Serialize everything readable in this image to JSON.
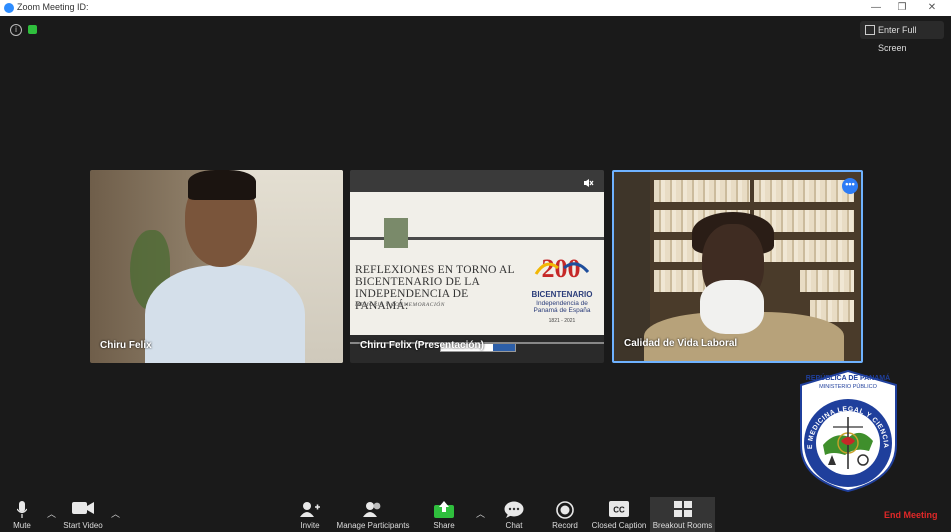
{
  "window": {
    "title": "Zoom Meeting ID:"
  },
  "top_controls": {
    "fullscreen_label": "Enter Full Screen"
  },
  "participants": [
    {
      "name": "Chiru Felix"
    },
    {
      "name": "Chiru Felix (Presentación)"
    },
    {
      "name": "Calidad de Vida Laboral"
    }
  ],
  "slide": {
    "title": "REFLEXIONES EN TORNO AL BICENTENARIO DE LA INDEPENDENCIA DE PANAMÁ:",
    "subtitle": "MEMORIA Y CONMEMORACIÓN",
    "logo_big": "200",
    "brand": "BICENTENARIO",
    "brand_sub": "Independencia de Panamá de España",
    "years": "1821 - 2021"
  },
  "emblem": {
    "top_text": "REPÚBLICA DE PANAMÁ",
    "sub_text": "MINISTERIO PÚBLICO",
    "ring_text": "INSTITUTO DE MEDICINA LEGAL Y CIENCIAS FORENSES"
  },
  "toolbar": {
    "mute": "Mute",
    "start_video": "Start Video",
    "invite": "Invite",
    "manage_participants": "Manage Participants",
    "share": "Share",
    "chat": "Chat",
    "record": "Record",
    "closed_caption": "Closed Caption",
    "cc_icon_text": "CC",
    "breakout_rooms": "Breakout Rooms",
    "end_meeting": "End Meeting"
  },
  "colors": {
    "background": "#1a1a1a",
    "active_speaker_border": "#6fb2ff",
    "share_green": "#2fbf3d",
    "end_red": "#e02828"
  }
}
